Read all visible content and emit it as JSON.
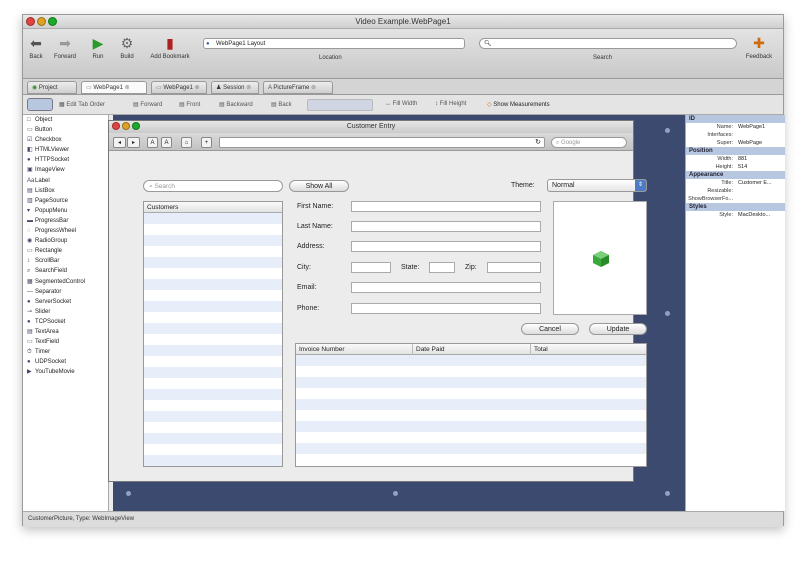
{
  "window": {
    "title": "Video Example.WebPage1"
  },
  "toolbar": {
    "buttons": [
      {
        "label": "Back",
        "icon": "left-arrow-icon"
      },
      {
        "label": "Forward",
        "icon": "right-arrow-icon"
      },
      {
        "label": "Run",
        "icon": "play-icon"
      },
      {
        "label": "Build",
        "icon": "gear-icon"
      },
      {
        "label": "Add Bookmark",
        "icon": "bookmark-icon"
      }
    ],
    "location_value": "WebPage1 Layout",
    "location_label": "Location",
    "search_label": "Search",
    "feedback_label": "Feedback"
  },
  "tabs": [
    {
      "label": "Project"
    },
    {
      "label": "WebPage1"
    },
    {
      "label": "WebPage1"
    },
    {
      "label": "Session"
    },
    {
      "label": "PictureFrame"
    }
  ],
  "layout_toolbar": {
    "items": [
      "Edit Tab Order",
      "Forward",
      "Front",
      "Backward",
      "Back",
      "Fill Width",
      "Fill Height",
      "Show Measurements"
    ]
  },
  "palette": {
    "items": [
      "Object",
      "Button",
      "Checkbox",
      "HTMLViewer",
      "HTTPSocket",
      "ImageView",
      "Label",
      "ListBox",
      "PageSource",
      "PopupMenu",
      "ProgressBar",
      "ProgressWheel",
      "RadioGroup",
      "Rectangle",
      "ScrollBar",
      "SearchField",
      "SegmentedControl",
      "Separator",
      "ServerSocket",
      "Slider",
      "TCPSocket",
      "TextArea",
      "TextField",
      "Timer",
      "UDPSocket",
      "YouTubeMovie"
    ]
  },
  "webpage": {
    "title": "Customer Entry",
    "google_placeholder": "Google",
    "search_placeholder": "Search",
    "show_all_label": "Show All",
    "theme_label": "Theme:",
    "theme_value": "Normal",
    "customers_header": "Customers",
    "fields": {
      "first_name": "First Name:",
      "last_name": "Last Name:",
      "address": "Address:",
      "city": "City:",
      "state": "State:",
      "zip": "Zip:",
      "email": "Email:",
      "phone": "Phone:"
    },
    "cancel_label": "Cancel",
    "update_label": "Update",
    "invoice_columns": [
      "Invoice Number",
      "Date Paid",
      "Total"
    ]
  },
  "inspector": {
    "sections": {
      "id": "ID",
      "position": "Position",
      "appearance": "Appearance",
      "styles": "Styles"
    },
    "id_rows": [
      {
        "k": "Name:",
        "v": "WebPage1"
      },
      {
        "k": "Interfaces:",
        "v": ""
      },
      {
        "k": "Super:",
        "v": "WebPage"
      }
    ],
    "position_rows": [
      {
        "k": "Width:",
        "v": "881"
      },
      {
        "k": "Height:",
        "v": "514"
      }
    ],
    "appearance_rows": [
      {
        "k": "Title:",
        "v": "Customer E..."
      },
      {
        "k": "Resizable:",
        "v": ""
      },
      {
        "k": "ShowBrowserFo...",
        "v": ""
      }
    ],
    "style_rows": [
      {
        "k": "Style:",
        "v": "MacDeskto..."
      }
    ]
  },
  "status_text": "CustomerPicture, Type: WebImageView",
  "colors": {
    "canvas": "#3b4a6e",
    "accent": "#b8c7e0"
  }
}
